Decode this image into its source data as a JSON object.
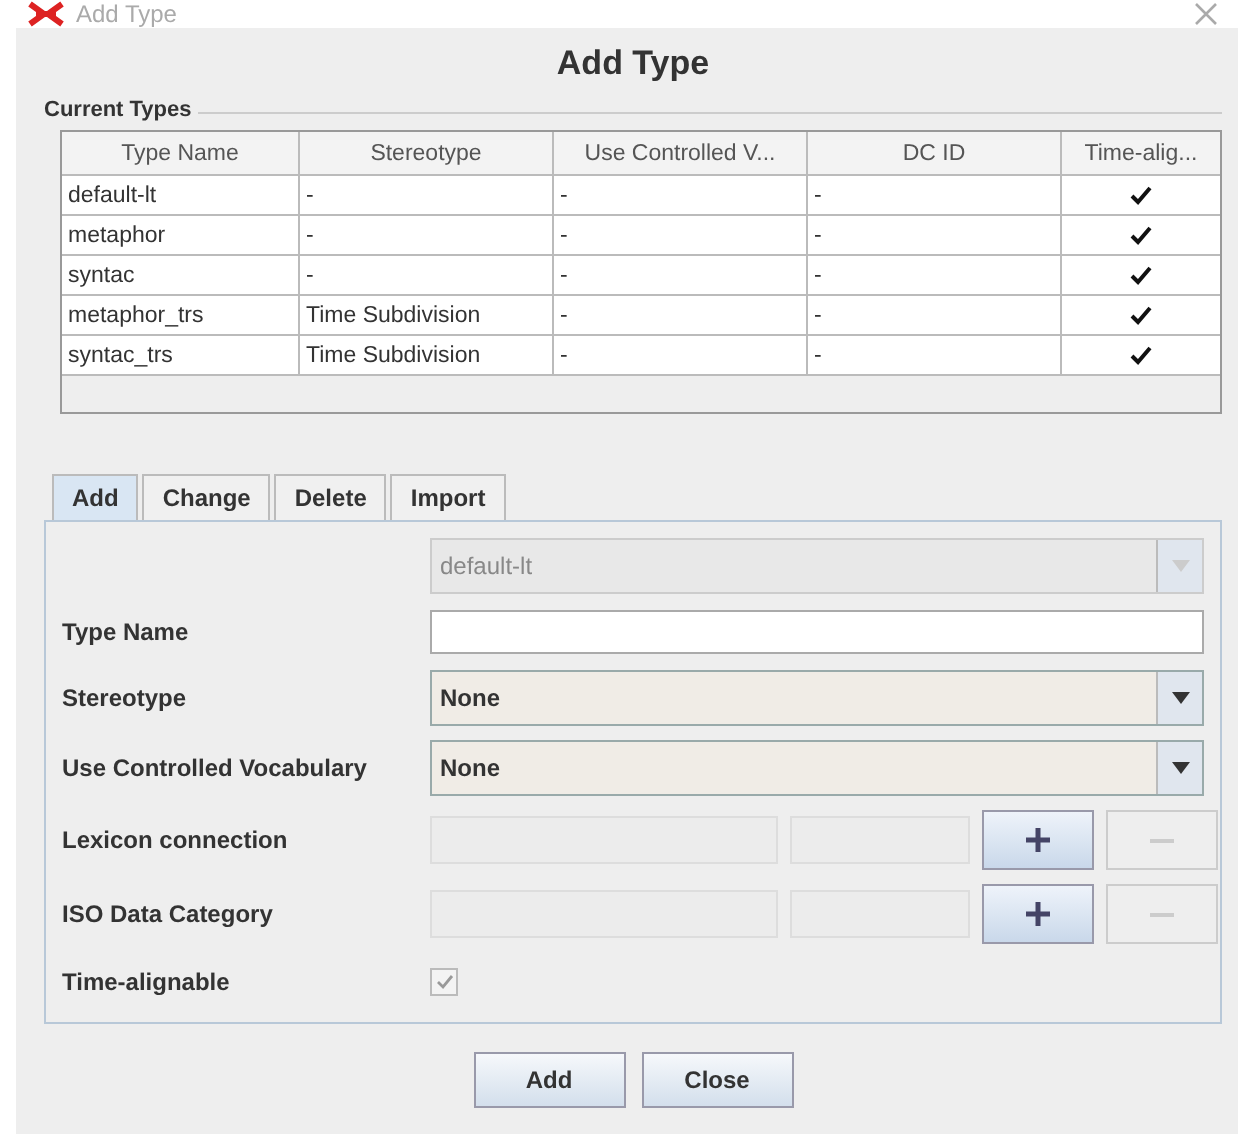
{
  "window": {
    "title": "Add Type"
  },
  "heading": "Add Type",
  "current_types": {
    "title": "Current Types",
    "columns": [
      "Type Name",
      "Stereotype",
      "Use Controlled V...",
      "DC ID",
      "Time-alig..."
    ],
    "rows": [
      {
        "name": "default-lt",
        "stereotype": "-",
        "vocabulary": "-",
        "dc_id": "-",
        "time_alignable": true
      },
      {
        "name": "metaphor",
        "stereotype": "-",
        "vocabulary": "-",
        "dc_id": "-",
        "time_alignable": true
      },
      {
        "name": "syntac",
        "stereotype": "-",
        "vocabulary": "-",
        "dc_id": "-",
        "time_alignable": true
      },
      {
        "name": "metaphor_trs",
        "stereotype": "Time Subdivision",
        "vocabulary": "-",
        "dc_id": "-",
        "time_alignable": true
      },
      {
        "name": "syntac_trs",
        "stereotype": "Time Subdivision",
        "vocabulary": "-",
        "dc_id": "-",
        "time_alignable": true
      }
    ]
  },
  "tabs": [
    {
      "label": "Add",
      "selected": true
    },
    {
      "label": "Change",
      "selected": false
    },
    {
      "label": "Delete",
      "selected": false
    },
    {
      "label": "Import",
      "selected": false
    }
  ],
  "form": {
    "type_selector": {
      "value": "default-lt",
      "disabled": true
    },
    "type_name": {
      "label": "Type Name"
    },
    "stereotype": {
      "label": "Stereotype",
      "value": "None"
    },
    "vocabulary": {
      "label": "Use Controlled Vocabulary",
      "value": "None"
    },
    "connections": [
      {
        "label": "Lexicon connection",
        "add_disabled": false,
        "remove_disabled": true
      },
      {
        "label": "ISO Data Category",
        "add_disabled": false,
        "remove_disabled": true
      }
    ],
    "time_alignable": {
      "label": "Time-alignable",
      "checked": true,
      "disabled": true
    }
  },
  "buttons": [
    "Add",
    "Close"
  ]
}
